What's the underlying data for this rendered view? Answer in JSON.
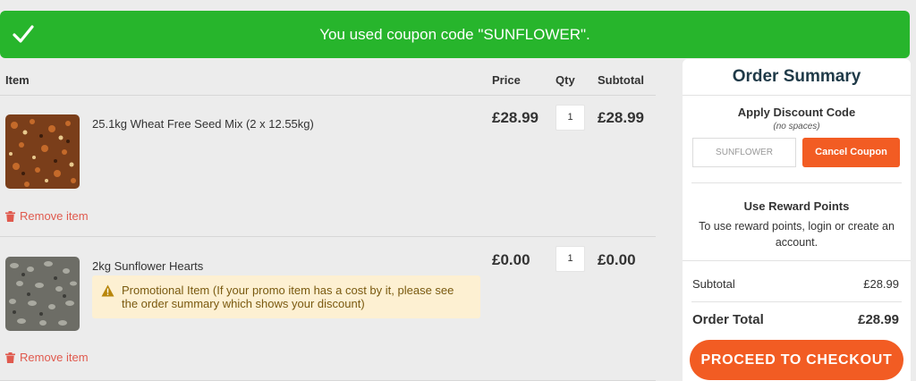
{
  "banner": {
    "message": "You used coupon code \"SUNFLOWER\".",
    "icon": "checkmark-icon",
    "color": "#27b52c"
  },
  "cart": {
    "columns": {
      "item": "Item",
      "price": "Price",
      "qty": "Qty",
      "subtotal": "Subtotal"
    },
    "items": [
      {
        "name": "25.1kg Wheat Free Seed Mix (2 x 12.55kg)",
        "price": "£28.99",
        "qty": "1",
        "subtotal": "£28.99",
        "remove": "Remove item",
        "image": "seed-mix-image"
      },
      {
        "name": "2kg Sunflower Hearts",
        "price": "£0.00",
        "qty": "1",
        "subtotal": "£0.00",
        "remove": "Remove item",
        "image": "sunflower-hearts-image",
        "promo": "Promotional Item (If your promo item has a cost by it, please see the order summary which shows your discount)"
      }
    ]
  },
  "summary": {
    "title": "Order Summary",
    "discount": {
      "title": "Apply Discount Code",
      "note": "(no spaces)",
      "value": "SUNFLOWER",
      "cancel": "Cancel Coupon"
    },
    "rewards": {
      "title": "Use Reward Points",
      "text": "To use reward points, login or create an account."
    },
    "subtotal_label": "Subtotal",
    "subtotal_value": "£28.99",
    "total_label": "Order Total",
    "total_value": "£28.99",
    "checkout": "PROCEED TO CHECKOUT",
    "accent": "#f25c23"
  }
}
